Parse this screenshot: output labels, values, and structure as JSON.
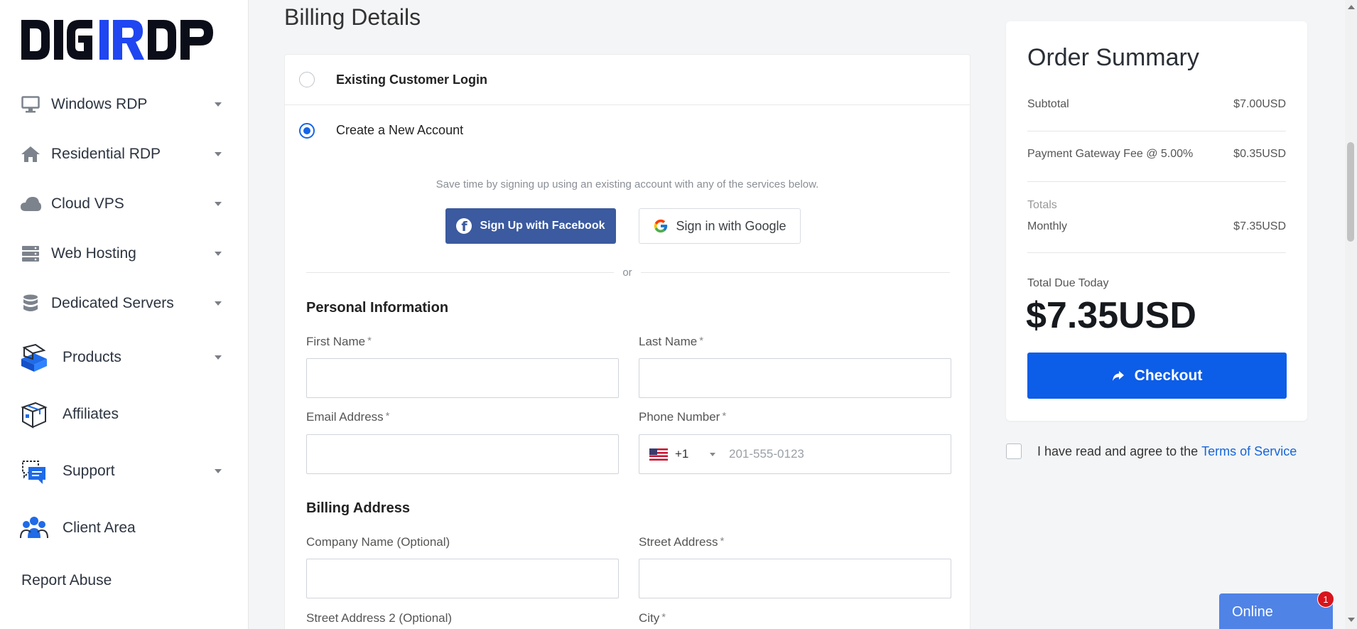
{
  "brand": {
    "logo_text": "DIGIRDP",
    "accent": "#1565e6",
    "logo_dark": "#0b0d18",
    "logo_blue": "#1f46f0"
  },
  "sidebar": {
    "items": [
      {
        "label": "Windows RDP",
        "icon": "monitor-icon"
      },
      {
        "label": "Residential RDP",
        "icon": "home-icon"
      },
      {
        "label": "Cloud VPS",
        "icon": "cloud-icon"
      },
      {
        "label": "Web Hosting",
        "icon": "server-stack-icon"
      },
      {
        "label": "Dedicated Servers",
        "icon": "database-icon"
      },
      {
        "label": "Products",
        "icon": "product-box-icon"
      },
      {
        "label": "Affiliates",
        "icon": "package-icon"
      },
      {
        "label": "Support",
        "icon": "support-chat-icon"
      },
      {
        "label": "Client Area",
        "icon": "users-group-icon"
      }
    ],
    "report_abuse": "Report Abuse"
  },
  "main": {
    "title": "Billing Details",
    "account_options": {
      "existing": "Existing Customer Login",
      "new": "Create a New Account"
    },
    "social": {
      "hint": "Save time by signing up using an existing account with any of the services below.",
      "facebook": "Sign Up with Facebook",
      "google": "Sign in with Google",
      "or": "or"
    },
    "personal": {
      "heading": "Personal Information",
      "first_name": "First Name",
      "last_name": "Last Name",
      "email": "Email Address",
      "phone": "Phone Number",
      "phone_code": "+1",
      "phone_placeholder": "201-555-0123",
      "required_mark": "*"
    },
    "billing": {
      "heading": "Billing Address",
      "company": "Company Name (Optional)",
      "street": "Street Address",
      "street2": "Street Address 2 (Optional)",
      "city": "City"
    }
  },
  "summary": {
    "title": "Order Summary",
    "subtotal_label": "Subtotal",
    "subtotal_value": "$7.00USD",
    "fee_label": "Payment Gateway Fee @ 5.00%",
    "fee_value": "$0.35USD",
    "totals_label": "Totals",
    "monthly_label": "Monthly",
    "monthly_value": "$7.35USD",
    "due_label": "Total Due Today",
    "due_value": "$7.35USD",
    "checkout": "Checkout"
  },
  "tos": {
    "text": "I have read and agree to the",
    "link": "Terms of Service"
  },
  "chat": {
    "label": "Online",
    "badge": "1"
  }
}
